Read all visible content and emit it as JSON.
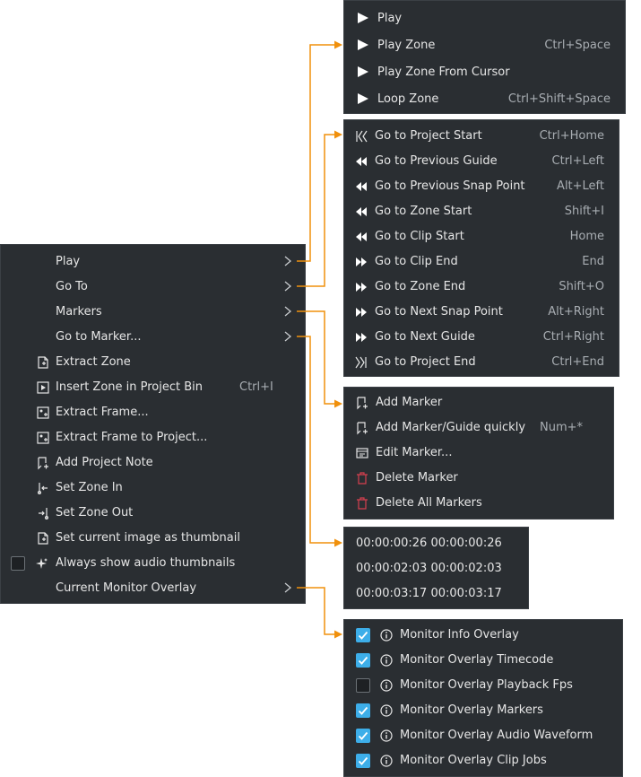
{
  "main_menu": {
    "items": [
      {
        "label": "Play"
      },
      {
        "label": "Go To"
      },
      {
        "label": "Markers"
      },
      {
        "label": "Go to Marker..."
      },
      {
        "label": "Extract Zone"
      },
      {
        "label": "Insert Zone in Project Bin",
        "shortcut": "Ctrl+I"
      },
      {
        "label": "Extract Frame..."
      },
      {
        "label": "Extract Frame to Project..."
      },
      {
        "label": "Add Project Note"
      },
      {
        "label": "Set Zone In"
      },
      {
        "label": "Set Zone Out"
      },
      {
        "label": "Set current image as thumbnail"
      },
      {
        "label": "Always show audio thumbnails"
      },
      {
        "label": "Current Monitor Overlay"
      }
    ]
  },
  "play_menu": {
    "items": [
      {
        "label": "Play",
        "shortcut": ""
      },
      {
        "label": "Play Zone",
        "shortcut": "Ctrl+Space"
      },
      {
        "label": "Play Zone From Cursor",
        "shortcut": ""
      },
      {
        "label": "Loop Zone",
        "shortcut": "Ctrl+Shift+Space"
      }
    ]
  },
  "goto_menu": {
    "items": [
      {
        "label": "Go to Project Start",
        "shortcut": "Ctrl+Home"
      },
      {
        "label": "Go to Previous Guide",
        "shortcut": "Ctrl+Left"
      },
      {
        "label": "Go to Previous Snap Point",
        "shortcut": "Alt+Left"
      },
      {
        "label": "Go to Zone Start",
        "shortcut": "Shift+I"
      },
      {
        "label": "Go to Clip Start",
        "shortcut": "Home"
      },
      {
        "label": "Go to Clip End",
        "shortcut": "End"
      },
      {
        "label": "Go to Zone End",
        "shortcut": "Shift+O"
      },
      {
        "label": "Go to Next Snap Point",
        "shortcut": "Alt+Right"
      },
      {
        "label": "Go to Next Guide",
        "shortcut": "Ctrl+Right"
      },
      {
        "label": "Go to Project End",
        "shortcut": "Ctrl+End"
      }
    ]
  },
  "markers_menu": {
    "items": [
      {
        "label": "Add Marker",
        "shortcut": ""
      },
      {
        "label": "Add Marker/Guide quickly",
        "shortcut": "Num+*"
      },
      {
        "label": "Edit Marker...",
        "shortcut": ""
      },
      {
        "label": "Delete Marker",
        "shortcut": ""
      },
      {
        "label": "Delete All Markers",
        "shortcut": ""
      }
    ]
  },
  "goto_marker_menu": {
    "items": [
      {
        "label": "00:00:00:26 00:00:00:26"
      },
      {
        "label": "00:00:02:03 00:00:02:03"
      },
      {
        "label": "00:00:03:17 00:00:03:17"
      }
    ]
  },
  "overlay_menu": {
    "items": [
      {
        "label": "Monitor Info Overlay",
        "checked": true
      },
      {
        "label": "Monitor Overlay Timecode",
        "checked": true
      },
      {
        "label": "Monitor Overlay Playback Fps",
        "checked": false
      },
      {
        "label": "Monitor Overlay Markers",
        "checked": true
      },
      {
        "label": "Monitor Overlay Audio Waveform",
        "checked": true
      },
      {
        "label": "Monitor Overlay Clip Jobs",
        "checked": true
      }
    ]
  },
  "colors": {
    "menu_bg": "#2a2e32",
    "text": "#e6e6e6",
    "shortcut_text": "#a8adb2",
    "connector": "#f0900c",
    "checkbox_accent": "#3daee9",
    "delete_icon": "#d6404f"
  }
}
